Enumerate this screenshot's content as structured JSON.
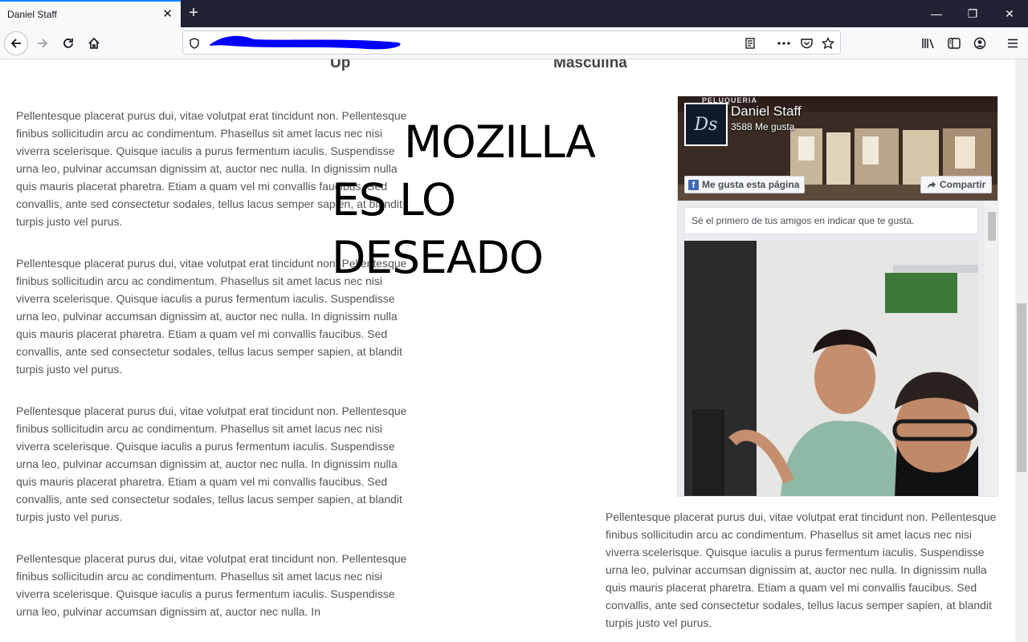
{
  "browser": {
    "tab_title": "Daniel Staff",
    "tab_close_glyph": "✕",
    "new_tab_glyph": "+",
    "window_controls": {
      "minimize": "—",
      "restore": "❐",
      "close": "✕"
    }
  },
  "page": {
    "nav": {
      "left": "Up",
      "right": "Masculina"
    },
    "overlay": {
      "line1": "MOZILLA",
      "line2": "ES LO DESEADO"
    },
    "paragraph": "Pellentesque placerat purus dui, vitae volutpat erat tincidunt non. Pellentesque finibus sollicitudin arcu ac condimentum. Phasellus sit amet lacus nec nisi viverra scelerisque. Quisque iaculis a purus fermentum iaculis. Suspendisse urna leo, pulvinar accumsan dignissim at, auctor nec nulla. In dignissim nulla quis mauris placerat pharetra. Etiam a quam vel mi convallis faucibus. Sed convallis, ante sed consectetur sodales, tellus lacus semper sapien, at blandit turpis justo vel purus.",
    "paragraph_partial": "Pellentesque placerat purus dui, vitae volutpat erat tincidunt non. Pellentesque finibus sollicitudin arcu ac condimentum. Phasellus sit amet lacus nec nisi viverra scelerisque. Quisque iaculis a purus fermentum iaculis. Suspendisse urna leo, pulvinar accumsan dignissim at, auctor nec nulla. In"
  },
  "facebook": {
    "cover_label": "PELUQUERIA",
    "page_name": "Daniel Staff",
    "likes": "3588 Me gusta",
    "like_button": "Me gusta esta página",
    "share_button": "Compartir",
    "friends_text": "Sé el primero de tus amigos en indicar que te gusta.",
    "logo_text": "Ds",
    "brand_color": "#4267b2"
  },
  "colors": {
    "tabbar": "#1f2233",
    "tab_accent": "#0a84ff",
    "url_scribble": "#0000ff"
  }
}
